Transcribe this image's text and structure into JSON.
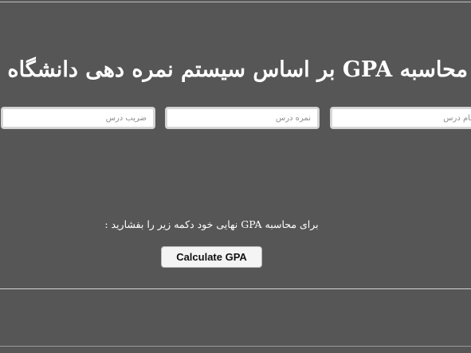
{
  "header": {
    "title": "محاسبه GPA بر اساس سیستم نمره دهی دانشگاه های"
  },
  "course_row": {
    "coefficient_placeholder": "ضریب درس",
    "grade_placeholder": "نمره درس",
    "name_placeholder": "نام درس"
  },
  "instruction": "برای محاسبه GPA نهایی خود دکمه زیر را بفشارید :",
  "actions": {
    "calculate_label": "Calculate GPA"
  },
  "colors": {
    "background": "#565656",
    "text": "#ffffff",
    "button_background": "#f4f4f4"
  }
}
